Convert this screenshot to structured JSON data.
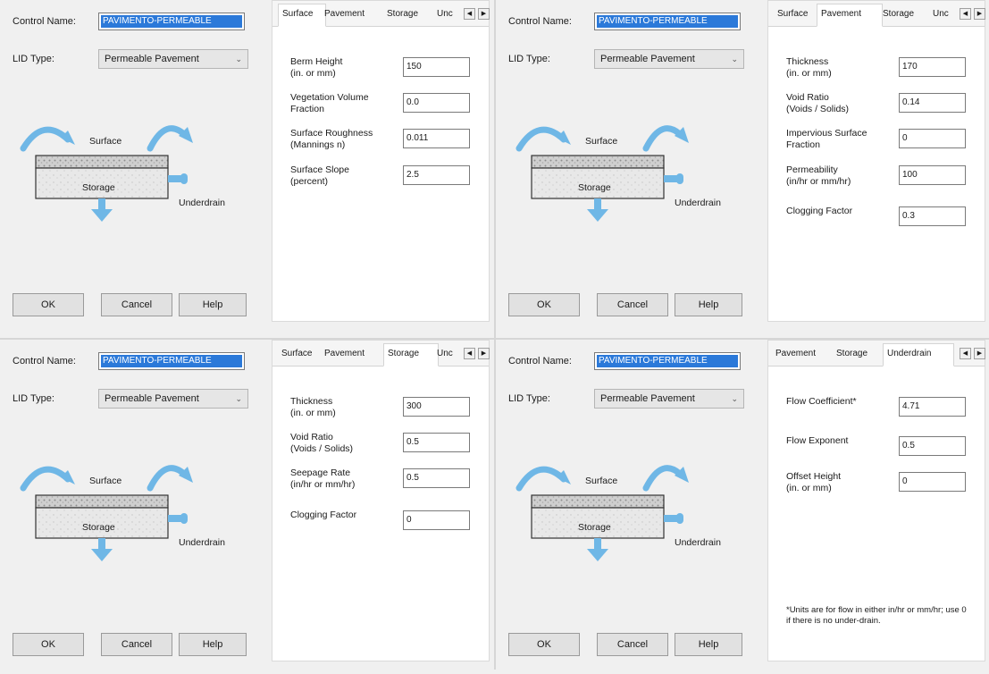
{
  "dialog": {
    "control_name_label": "Control Name:",
    "control_name_value": "PAVIMENTO-PERMEABLE",
    "lid_type_label": "LID Type:",
    "lid_type_value": "Permeable Pavement",
    "ok_label": "OK",
    "cancel_label": "Cancel",
    "help_label": "Help"
  },
  "diagram": {
    "surface_label": "Surface",
    "storage_label": "Storage",
    "underdrain_label": "Underdrain",
    "arrow_color": "#6fb7e6",
    "soil_color": "#bdbdbd"
  },
  "quads": [
    {
      "tabs": [
        "Surface",
        "Pavement",
        "Storage",
        "Unc"
      ],
      "active_tab": 0,
      "fields": [
        {
          "label1": "Berm Height",
          "label2": "(in. or mm)",
          "value": "150"
        },
        {
          "label1": "Vegetation Volume",
          "label2": "Fraction",
          "value": "0.0"
        },
        {
          "label1": "Surface Roughness",
          "label2": "(Mannings n)",
          "value": "0.011"
        },
        {
          "label1": "Surface Slope",
          "label2": "(percent)",
          "value": "2.5"
        }
      ]
    },
    {
      "tabs": [
        "Surface",
        "Pavement",
        "Storage",
        "Unc"
      ],
      "active_tab": 1,
      "fields": [
        {
          "label1": "Thickness",
          "label2": "(in. or mm)",
          "value": "170"
        },
        {
          "label1": "Void Ratio",
          "label2": "(Voids / Solids)",
          "value": "0.14"
        },
        {
          "label1": "Impervious Surface",
          "label2": "Fraction",
          "value": "0"
        },
        {
          "label1": "Permeability",
          "label2": "(in/hr or mm/hr)",
          "value": "100"
        },
        {
          "label1": "Clogging Factor",
          "label2": "",
          "value": "0.3"
        }
      ]
    },
    {
      "tabs": [
        "Surface",
        "Pavement",
        "Storage",
        "Unc"
      ],
      "active_tab": 2,
      "fields": [
        {
          "label1": "Thickness",
          "label2": "(in. or mm)",
          "value": "300"
        },
        {
          "label1": "Void Ratio",
          "label2": "(Voids / Solids)",
          "value": "0.5"
        },
        {
          "label1": "Seepage Rate",
          "label2": "(in/hr or mm/hr)",
          "value": "0.5"
        },
        {
          "label1": "Clogging Factor",
          "label2": "",
          "value": "0"
        }
      ]
    },
    {
      "tabs": [
        "Pavement",
        "Storage",
        "Underdrain"
      ],
      "active_tab": 2,
      "fields": [
        {
          "label1": "Flow Coefficient*",
          "label2": "",
          "value": "4.71"
        },
        {
          "label1": "Flow Exponent",
          "label2": "",
          "value": "0.5"
        },
        {
          "label1": "Offset Height",
          "label2": "(in. or mm)",
          "value": "0"
        }
      ],
      "note": "*Units are for flow in either in/hr or mm/hr; use 0 if there is no under-drain."
    }
  ]
}
